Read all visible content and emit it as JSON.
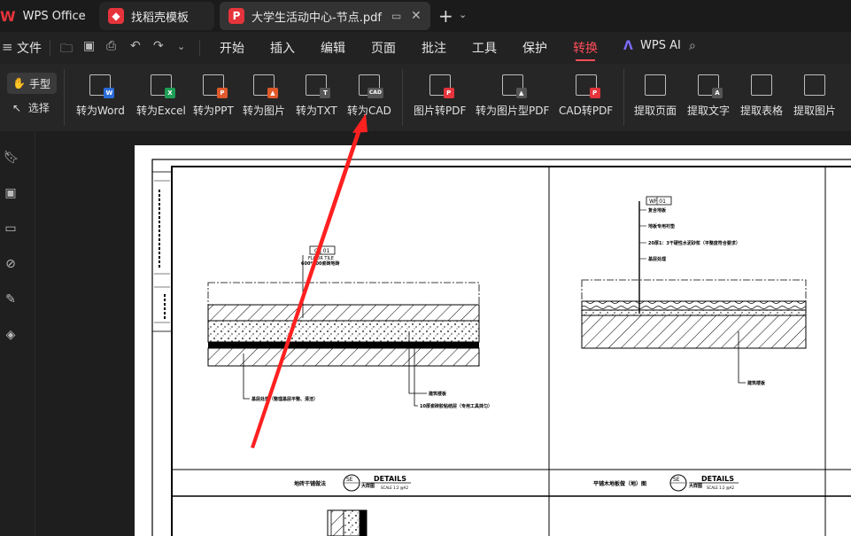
{
  "tabs": {
    "wps_label": "WPS Office",
    "template_label": "找稻壳模板",
    "doc_label": "大学生活动中心-节点.pdf"
  },
  "menu": {
    "file": "文件",
    "items": [
      "开始",
      "插入",
      "编辑",
      "页面",
      "批注",
      "工具",
      "保护",
      "转换"
    ],
    "active": "转换",
    "ai": "WPS AI"
  },
  "ribbon": {
    "hand": "手型",
    "select": "选择",
    "buttons": [
      "转为Word",
      "转为Excel",
      "转为PPT",
      "转为图片",
      "转为TXT",
      "转为CAD",
      "图片转PDF",
      "转为图片型PDF",
      "CAD转PDF",
      "提取页面",
      "提取文字",
      "提取表格",
      "提取图片"
    ],
    "badges": [
      "W",
      "X",
      "P",
      "",
      "T",
      "CAD",
      "",
      "",
      "CAD",
      "",
      "A",
      "",
      ""
    ]
  },
  "drawing": {
    "left_tag": "CT 01",
    "left_tag_sub": "FLOOR TILE",
    "left_tag_sub2": "600*600瓷砖地砖",
    "left_note1": "基层处理（整理基层平整、清洁）",
    "left_note2": "建筑楼板",
    "left_note3": "10厚瓷砖胶粘结层（专用工具抹匀）",
    "right_tag": "WF 01",
    "right_notes": [
      "复合地板",
      "地板专用衬垫",
      "20厚1：3干硬性水泥砂浆（平整度符合要求）",
      "基层处理"
    ],
    "right_note_bottom": "建筑楼板",
    "left_title": "地砖干铺做法",
    "left_title2": "大样图",
    "right_title": "平铺木地板做（地）图",
    "right_title2": "大样图",
    "se": "SE",
    "details": "DETAILS",
    "scale": "SCALE 1:2 @A2"
  }
}
